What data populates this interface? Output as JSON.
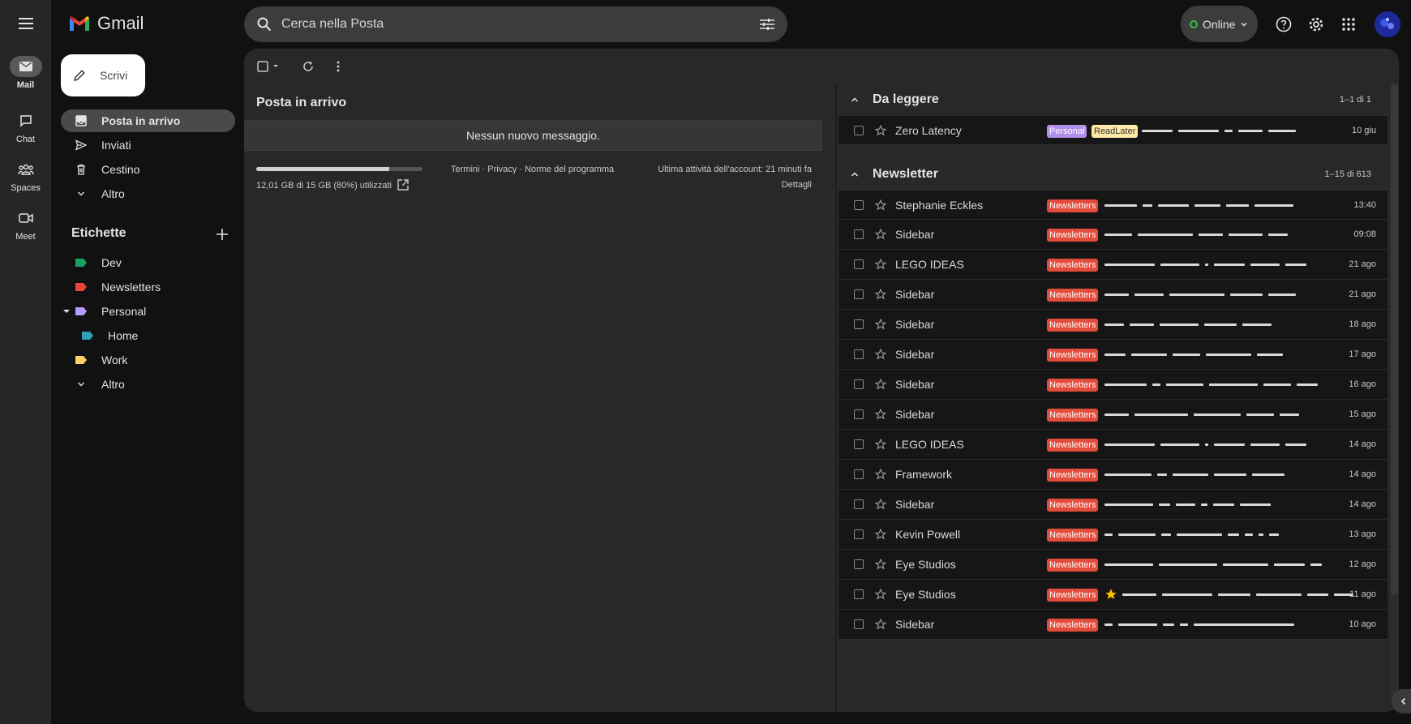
{
  "app": {
    "name": "Gmail"
  },
  "rail": [
    {
      "label": "Mail",
      "icon": "mail-icon",
      "active": true
    },
    {
      "label": "Chat",
      "icon": "chat-icon"
    },
    {
      "label": "Spaces",
      "icon": "spaces-icon"
    },
    {
      "label": "Meet",
      "icon": "meet-icon"
    }
  ],
  "search": {
    "placeholder": "Cerca nella Posta"
  },
  "status": {
    "label": "Online",
    "color": "#33c24d"
  },
  "compose": {
    "label": "Scrivi"
  },
  "nav": [
    {
      "label": "Posta in arrivo",
      "icon": "inbox-icon",
      "active": true
    },
    {
      "label": "Inviati",
      "icon": "send-icon"
    },
    {
      "label": "Cestino",
      "icon": "trash-icon"
    },
    {
      "label": "Altro",
      "icon": "chevron-down-icon"
    }
  ],
  "labels": {
    "heading": "Etichette",
    "items": [
      {
        "label": "Dev",
        "color": "#1aa260"
      },
      {
        "label": "Newsletters",
        "color": "#e8453c"
      },
      {
        "label": "Personal",
        "color": "#b99aff"
      },
      {
        "label": "Home",
        "color": "#2da2bb"
      },
      {
        "label": "Work",
        "color": "#fad165"
      }
    ],
    "more": "Altro"
  },
  "inbox": {
    "title": "Posta in arrivo",
    "empty_message": "Nessun nuovo messaggio.",
    "storage_text": "12,01 GB di 15 GB (80%) utilizzati",
    "storage_fraction": 0.8,
    "footer_links": [
      "Termini",
      "Privacy",
      "Norme del programma"
    ],
    "last_activity": "Ultima attività dell'account: 21 minuti fa",
    "details": "Dettagli"
  },
  "sections": {
    "read_later": {
      "title": "Da leggere",
      "count": "1–1 di 1",
      "rows": [
        {
          "sender": "Zero Latency",
          "chips": [
            "Personal",
            "ReadLater"
          ],
          "date": "10 giu"
        }
      ]
    },
    "newsletter": {
      "title": "Newsletter",
      "count": "1–15 di 613",
      "chip": "Newsletters",
      "rows": [
        {
          "sender": "Stephanie Eckles",
          "date": "13:40"
        },
        {
          "sender": "Sidebar",
          "date": "09:08"
        },
        {
          "sender": "LEGO IDEAS",
          "date": "21 ago"
        },
        {
          "sender": "Sidebar",
          "date": "21 ago"
        },
        {
          "sender": "Sidebar",
          "date": "18 ago"
        },
        {
          "sender": "Sidebar",
          "date": "17 ago"
        },
        {
          "sender": "Sidebar",
          "date": "16 ago"
        },
        {
          "sender": "Sidebar",
          "date": "15 ago"
        },
        {
          "sender": "LEGO IDEAS",
          "date": "14 ago"
        },
        {
          "sender": "Framework",
          "date": "14 ago"
        },
        {
          "sender": "Sidebar",
          "date": "14 ago"
        },
        {
          "sender": "Kevin Powell",
          "date": "13 ago"
        },
        {
          "sender": "Eye Studios",
          "date": "12 ago"
        },
        {
          "sender": "Eye Studios",
          "date": "11 ago",
          "starred_emoji": true
        },
        {
          "sender": "Sidebar",
          "date": "10 ago"
        }
      ]
    }
  }
}
